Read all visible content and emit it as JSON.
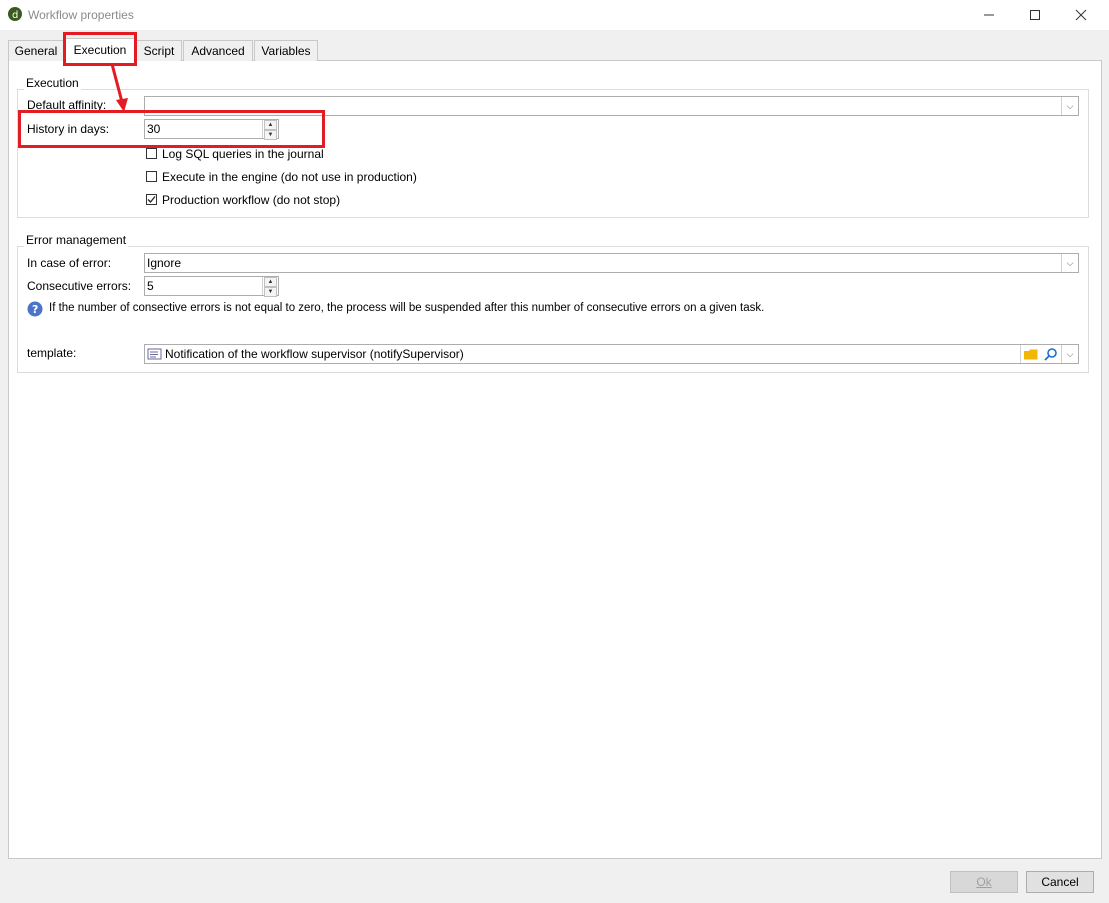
{
  "window": {
    "title": "Workflow properties",
    "icon": "app-logo-icon",
    "controls": [
      "minimize-icon",
      "maximize-icon",
      "close-icon"
    ]
  },
  "tabs": [
    {
      "label": "General",
      "active": false
    },
    {
      "label": "Execution",
      "active": true
    },
    {
      "label": "Script",
      "active": false
    },
    {
      "label": "Advanced",
      "active": false
    },
    {
      "label": "Variables",
      "active": false
    }
  ],
  "execution": {
    "legend": "Execution",
    "default_affinity_label": "Default affinity:",
    "default_affinity_value": "",
    "history_label": "History in days:",
    "history_value": "30",
    "checkboxes": [
      {
        "label": "Log SQL queries in the journal",
        "checked": false
      },
      {
        "label": "Execute in the engine (do not use in production)",
        "checked": false
      },
      {
        "label": "Production workflow (do not stop)",
        "checked": true
      }
    ]
  },
  "error_management": {
    "legend": "Error management",
    "in_case_label": "In case of error:",
    "in_case_value": "Ignore",
    "consecutive_label": "Consecutive errors:",
    "consecutive_value": "5",
    "info_text": "If the number of consective errors is not equal to zero, the process will be suspended after this number of consecutive errors on a given task.",
    "template_label": "template:",
    "template_value": "Notification of the workflow supervisor (notifySupervisor)"
  },
  "buttons": {
    "ok": "Ok",
    "cancel": "Cancel"
  },
  "colors": {
    "highlight": "#e31b23",
    "folder": "#f2b705",
    "search": "#1a6fd1"
  }
}
